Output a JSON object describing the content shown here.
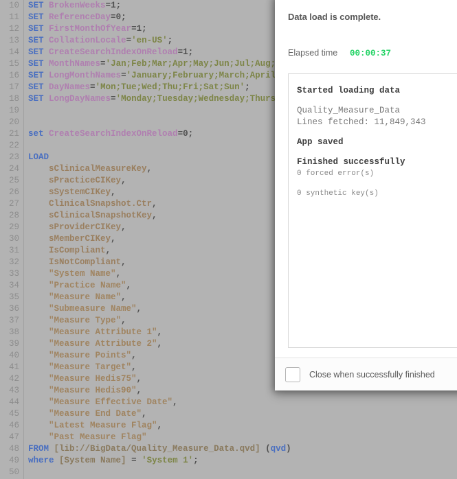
{
  "editor": {
    "first_line_number": 10,
    "lines": [
      {
        "n": 10,
        "text": "SET BrokenWeeks=1;"
      },
      {
        "n": 11,
        "text": "SET ReferenceDay=0;"
      },
      {
        "n": 12,
        "text": "SET FirstMonthOfYear=1;"
      },
      {
        "n": 13,
        "text": "SET CollationLocale='en-US';"
      },
      {
        "n": 14,
        "text": "SET CreateSearchIndexOnReload=1;"
      },
      {
        "n": 15,
        "text": "SET MonthNames='Jan;Feb;Mar;Apr;May;Jun;Jul;Aug;Sep;Oct;Nov;Dec';"
      },
      {
        "n": 16,
        "text": "SET LongMonthNames='January;February;March;April;May;June;July;August;September;October;November;December';"
      },
      {
        "n": 17,
        "text": "SET DayNames='Mon;Tue;Wed;Thu;Fri;Sat;Sun';"
      },
      {
        "n": 18,
        "text": "SET LongDayNames='Monday;Tuesday;Wednesday;Thursday;Friday;Saturday;Sunday';"
      },
      {
        "n": 19,
        "text": ""
      },
      {
        "n": 20,
        "text": ""
      },
      {
        "n": 21,
        "text": "set CreateSearchIndexOnReload=0;"
      },
      {
        "n": 22,
        "text": ""
      },
      {
        "n": 23,
        "text": "LOAD"
      },
      {
        "n": 24,
        "text": "    sClinicalMeasureKey,"
      },
      {
        "n": 25,
        "text": "    sPracticeCIKey,"
      },
      {
        "n": 26,
        "text": "    sSystemCIKey,"
      },
      {
        "n": 27,
        "text": "    ClinicalSnapshot.Ctr,"
      },
      {
        "n": 28,
        "text": "    sClinicalSnapshotKey,"
      },
      {
        "n": 29,
        "text": "    sProviderCIKey,"
      },
      {
        "n": 30,
        "text": "    sMemberCIKey,"
      },
      {
        "n": 31,
        "text": "    IsCompliant,"
      },
      {
        "n": 32,
        "text": "    IsNotCompliant,"
      },
      {
        "n": 33,
        "text": "    \"System Name\","
      },
      {
        "n": 34,
        "text": "    \"Practice Name\","
      },
      {
        "n": 35,
        "text": "    \"Measure Name\","
      },
      {
        "n": 36,
        "text": "    \"Submeasure Name\","
      },
      {
        "n": 37,
        "text": "    \"Measure Type\","
      },
      {
        "n": 38,
        "text": "    \"Measure Attribute 1\","
      },
      {
        "n": 39,
        "text": "    \"Measure Attribute 2\","
      },
      {
        "n": 40,
        "text": "    \"Measure Points\","
      },
      {
        "n": 41,
        "text": "    \"Measure Target\","
      },
      {
        "n": 42,
        "text": "    \"Measure Hedis75\","
      },
      {
        "n": 43,
        "text": "    \"Measure Hedis90\","
      },
      {
        "n": 44,
        "text": "    \"Measure Effective Date\","
      },
      {
        "n": 45,
        "text": "    \"Measure End Date\","
      },
      {
        "n": 46,
        "text": "    \"Latest Measure Flag\","
      },
      {
        "n": 47,
        "text": "    \"Past Measure Flag\""
      },
      {
        "n": 48,
        "text": "FROM [lib://BigData/Quality_Measure_Data.qvd] (qvd)"
      },
      {
        "n": 49,
        "text": "where [System Name] = 'System 1';"
      },
      {
        "n": 50,
        "text": ""
      }
    ]
  },
  "dialog": {
    "title": "Data load is complete.",
    "elapsed_label": "Elapsed time",
    "elapsed_value": "00:00:37",
    "log": [
      {
        "text": "Started loading data",
        "style": "bold"
      },
      {
        "text": "",
        "style": "gap"
      },
      {
        "text": "Quality_Measure_Data",
        "style": "norm"
      },
      {
        "text": "Lines fetched: 11,849,343",
        "style": "norm"
      },
      {
        "text": "",
        "style": "gap"
      },
      {
        "text": "App saved",
        "style": "bold"
      },
      {
        "text": "",
        "style": "gap"
      },
      {
        "text": "Finished successfully",
        "style": "bold"
      },
      {
        "text": "0 forced error(s)",
        "style": "dim"
      },
      {
        "text": "",
        "style": "gap"
      },
      {
        "text": "0 synthetic key(s)",
        "style": "dim"
      }
    ],
    "checkbox_label": "Close when successfully finished",
    "checkbox_checked": false
  },
  "colors": {
    "editor_background": "#b3b3b3",
    "keyword": "#4a6fc0",
    "variable": "#b07fb0",
    "string": "#7d8547",
    "field": "#9a7f5f",
    "line_number": "#8d8d8d",
    "elapsed_green": "#25d366",
    "dialog_background": "#ffffff"
  }
}
